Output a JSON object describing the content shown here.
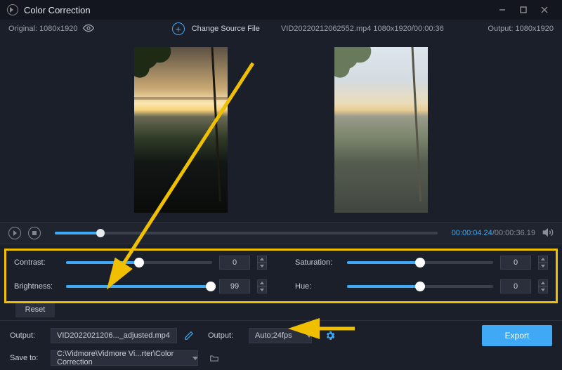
{
  "window": {
    "title": "Color Correction"
  },
  "top": {
    "original_label": "Original: 1080x1920",
    "change_source_label": "Change Source File",
    "source_info": "VID20220212062552.mp4    1080x1920/00:00:36",
    "output_label": "Output: 1080x1920"
  },
  "player": {
    "seek_percent": 12,
    "time_current": "00:00:04.24",
    "time_total": "00:00:36.19"
  },
  "sliders": {
    "contrast": {
      "label": "Contrast:",
      "value": "0",
      "percent": 50
    },
    "brightness": {
      "label": "Brightness:",
      "value": "99",
      "percent": 99
    },
    "saturation": {
      "label": "Saturation:",
      "value": "0",
      "percent": 50
    },
    "hue": {
      "label": "Hue:",
      "value": "0",
      "percent": 50
    },
    "reset_label": "Reset"
  },
  "output": {
    "label_file": "Output:",
    "file_value": "VID2022021206..._adjusted.mp4",
    "label_format": "Output:",
    "format_value": "Auto;24fps",
    "save_to_label": "Save to:",
    "save_to_value": "C:\\Vidmore\\Vidmore Vi...rter\\Color Correction",
    "export_label": "Export"
  }
}
